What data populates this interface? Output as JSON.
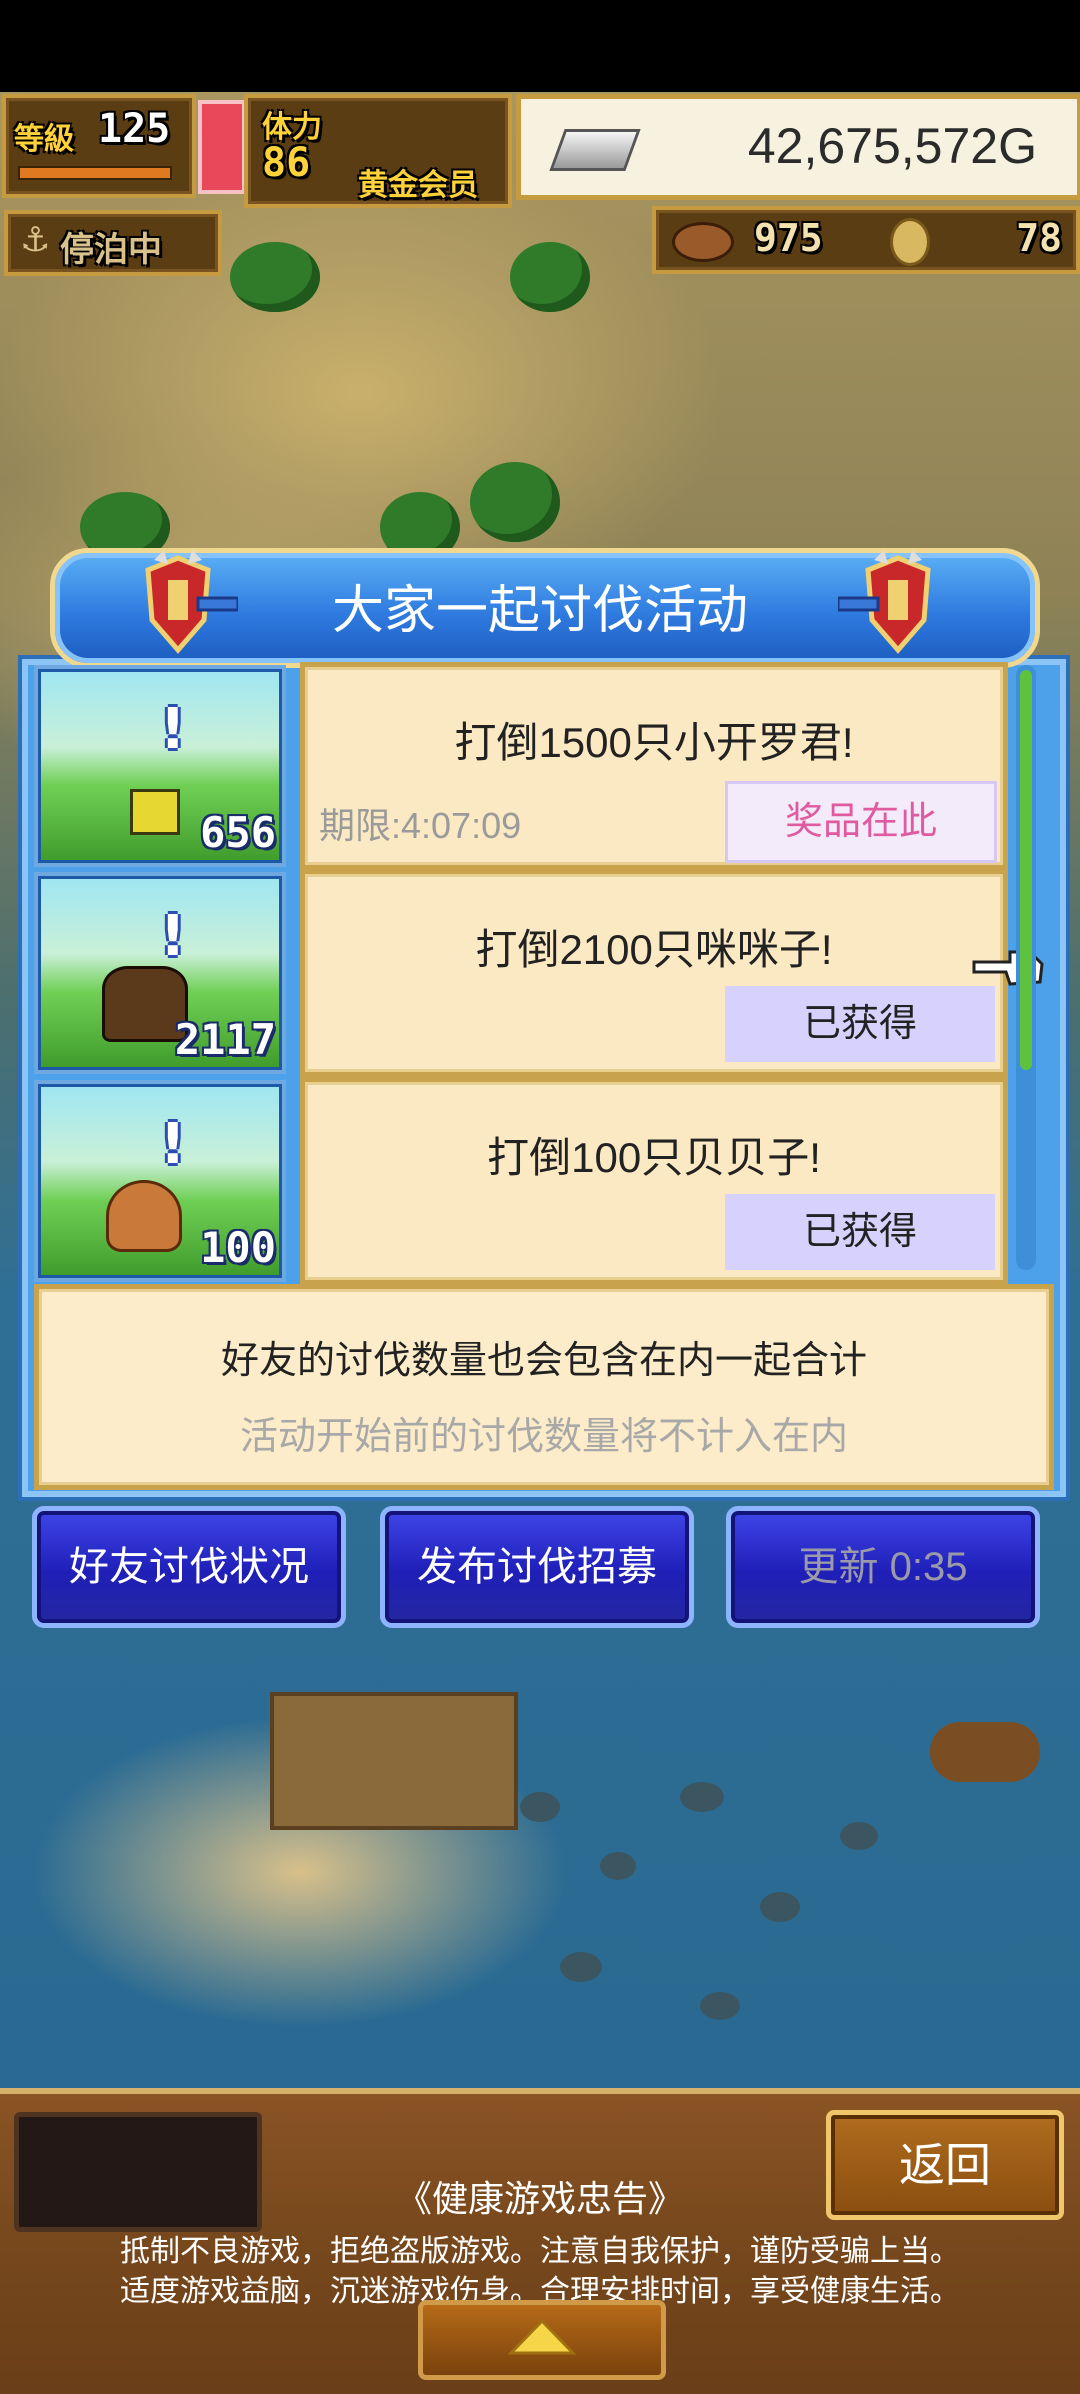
{
  "hud": {
    "level_label": "等級",
    "level_value": "125",
    "stamina_label": "体力",
    "stamina_value": "86",
    "membership": "黄金会员",
    "gold": "42,675,572G",
    "docking_status": "停泊中",
    "food_count": "975",
    "coin_count": "78"
  },
  "event": {
    "title": "大家一起讨伐活动",
    "rows": [
      {
        "title": "打倒1500只小开罗君!",
        "count": "656",
        "deadline": "期限:4:07:09",
        "status": "奖品在此"
      },
      {
        "title": "打倒2100只咪咪子!",
        "count": "2117",
        "status": "已获得"
      },
      {
        "title": "打倒100只贝贝子!",
        "count": "100",
        "status": "已获得"
      }
    ],
    "note_main": "好友的讨伐数量也会包含在内一起合计",
    "note_sub": "活动开始前的讨伐数量将不计入在内"
  },
  "actions": {
    "friend_status": "好友讨伐状况",
    "post_recruit": "发布讨伐招募",
    "refresh": "更新 0:35"
  },
  "bottom": {
    "back": "返回",
    "advisory_title": "《健康游戏忠告》",
    "advisory_line1": "抵制不良游戏，拒绝盗版游戏。注意自我保护，谨防受骗上当。",
    "advisory_line2": "适度游戏益脑，沉迷游戏伤身。合理安排时间，享受健康生活。"
  },
  "colors": {
    "reward_text": "#e05aa0",
    "obtained_text": "#222222",
    "refresh_text": "#9a9aa8",
    "note_sub_text": "#a8a8a8"
  }
}
